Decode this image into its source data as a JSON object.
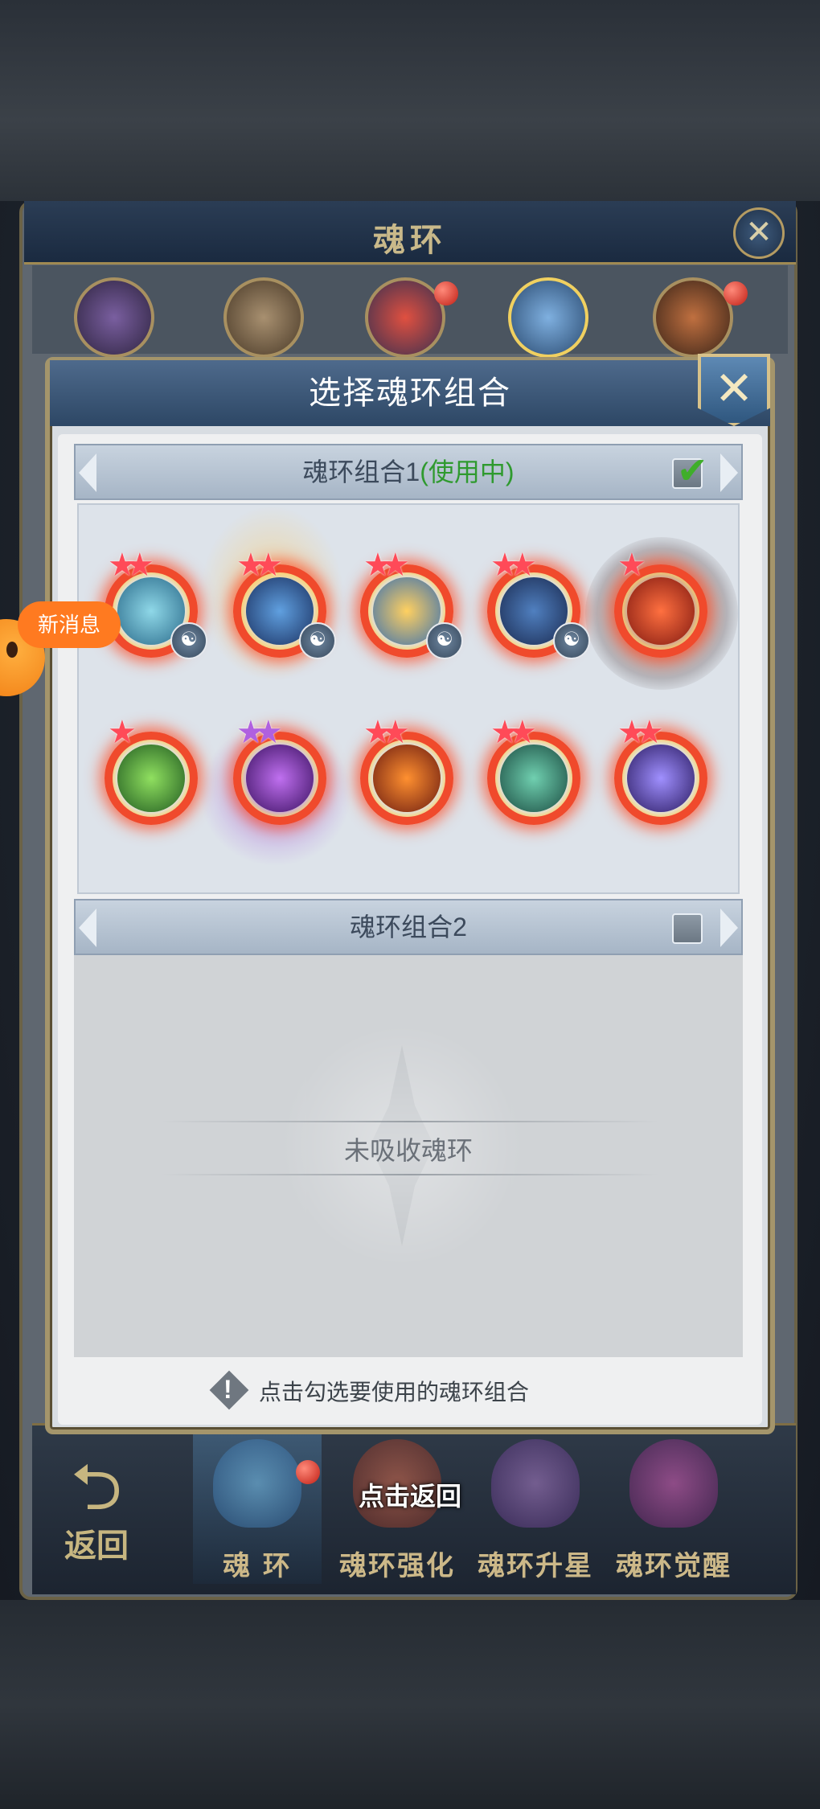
{
  "back_window": {
    "title": "魂环",
    "close_label": "✕"
  },
  "dialog": {
    "title": "选择魂环组合",
    "close_label": "✕"
  },
  "groups": [
    {
      "label": "魂环组合1",
      "status": "(使用中)",
      "checked": true
    },
    {
      "label": "魂环组合2",
      "status": "",
      "checked": false
    }
  ],
  "empty_text": "未吸收魂环",
  "hint": "点击勾选要使用的魂环组合",
  "new_message": "新消息",
  "return_hint": "点击返回",
  "bottom_nav": {
    "back_label": "返回",
    "tabs": [
      "魂 环",
      "魂环强化",
      "魂环升星",
      "魂环觉醒"
    ]
  },
  "soul_rings": [
    {
      "icon": "wind-spirit-icon",
      "stars": 2,
      "star_color": "red",
      "has_badge": true
    },
    {
      "icon": "blue-orb-spirit-icon",
      "stars": 2,
      "star_color": "red",
      "has_badge": true
    },
    {
      "icon": "golden-leaf-icon",
      "stars": 2,
      "star_color": "red",
      "has_badge": true
    },
    {
      "icon": "dark-beast-icon",
      "stars": 2,
      "star_color": "red",
      "has_badge": true
    },
    {
      "icon": "fire-dragon-icon",
      "stars": 1,
      "star_color": "red",
      "has_badge": false
    },
    {
      "icon": "green-clover-icon",
      "stars": 1,
      "star_color": "red",
      "has_badge": false
    },
    {
      "icon": "purple-demon-icon",
      "stars": 2,
      "star_color": "purple",
      "has_badge": false
    },
    {
      "icon": "flame-beast-icon",
      "stars": 2,
      "star_color": "red",
      "has_badge": false
    },
    {
      "icon": "jade-figure-icon",
      "stars": 2,
      "star_color": "red",
      "has_badge": false
    },
    {
      "icon": "lightning-orb-icon",
      "stars": 2,
      "star_color": "red",
      "has_badge": false
    }
  ],
  "colors": {
    "in_use": "#2f9a2f",
    "ring_red": "#f04a2c",
    "message_orange": "#ff7a20"
  }
}
